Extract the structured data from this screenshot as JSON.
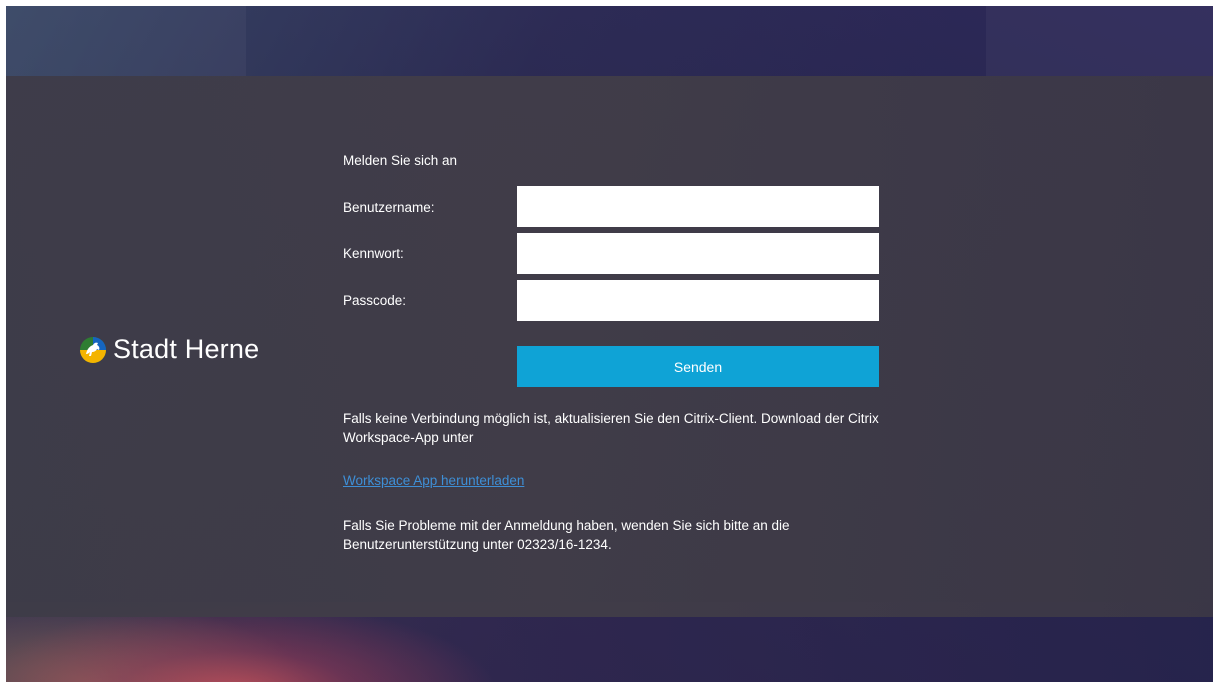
{
  "brand": {
    "name": "Stadt Herne",
    "logo_icon": "stadt-herne-horse-emblem"
  },
  "login": {
    "heading": "Melden Sie sich an",
    "username_label": "Benutzername:",
    "username_value": "",
    "password_label": "Kennwort:",
    "password_value": "",
    "passcode_label": "Passcode:",
    "passcode_value": "",
    "submit_label": "Senden"
  },
  "info": {
    "client_notice": "Falls keine Verbindung möglich ist, aktualisieren Sie den Citrix-Client. Download der Citrix Workspace-App unter",
    "download_link": "Workspace App herunterladen",
    "support_notice": "Falls Sie Probleme mit der Anmeldung haben, wenden Sie sich bitte an die Benutzerunterstützung unter 02323/16-1234."
  },
  "colors": {
    "accent_button": "#0fa3d6",
    "link": "#3e8fd6",
    "panel": "#3e3c48",
    "background": "#2b2d4e"
  }
}
